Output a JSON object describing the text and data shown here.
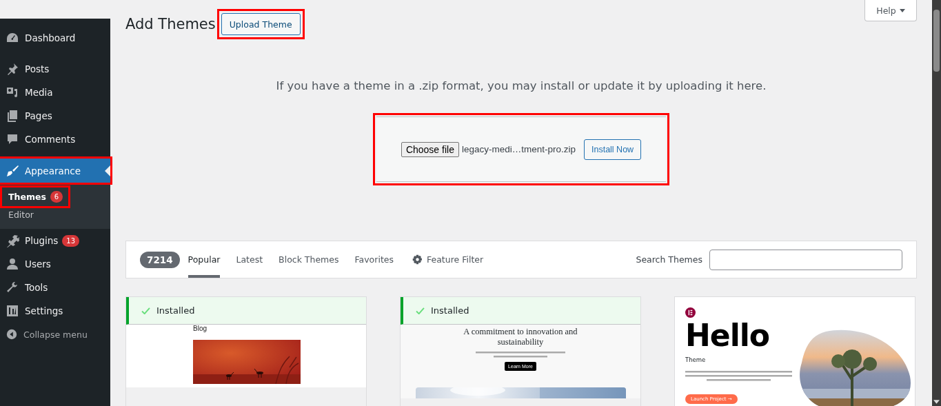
{
  "sidebar": {
    "items": [
      {
        "label": "Dashboard",
        "selected": false
      },
      {
        "label": "Posts",
        "selected": false
      },
      {
        "label": "Media",
        "selected": false
      },
      {
        "label": "Pages",
        "selected": false
      },
      {
        "label": "Comments",
        "selected": false
      },
      {
        "label": "Appearance",
        "selected": true,
        "highlighted": true,
        "children": [
          {
            "label": "Themes",
            "selected": true,
            "badge": "6",
            "highlighted": true
          },
          {
            "label": "Editor",
            "selected": false,
            "highlighted": false
          }
        ]
      },
      {
        "label": "Plugins",
        "selected": false,
        "badge": "13"
      },
      {
        "label": "Users",
        "selected": false
      },
      {
        "label": "Tools",
        "selected": false
      },
      {
        "label": "Settings",
        "selected": false
      }
    ],
    "collapse": "Collapse menu"
  },
  "help_button": {
    "label": "Help"
  },
  "page_title": "Add Themes",
  "upload_button": {
    "label": "Upload Theme",
    "highlighted": true
  },
  "upload_hint": "If you have a theme in a .zip format, you may install or update it by uploading it here.",
  "upload_form": {
    "highlighted": true,
    "file_button": "Choose file",
    "file_name": "legacy-medi…tment-pro.zip",
    "install_button": "Install Now"
  },
  "filter_bar": {
    "count": "7214",
    "tabs": [
      {
        "label": "Popular",
        "selected": true
      },
      {
        "label": "Latest",
        "selected": false
      },
      {
        "label": "Block Themes",
        "selected": false
      },
      {
        "label": "Favorites",
        "selected": false
      }
    ],
    "feature_filter": "Feature Filter",
    "search_label": "Search Themes"
  },
  "themes": [
    {
      "installed": true,
      "installed_label": "Installed",
      "preview": {
        "kind": "blog",
        "heading": "Blog"
      }
    },
    {
      "installed": true,
      "installed_label": "Installed",
      "preview": {
        "kind": "studio",
        "heading": "A commitment to innovation and sustainability",
        "button": "Learn More"
      }
    },
    {
      "installed": false,
      "preview": {
        "kind": "hello",
        "heading": "Hello",
        "subheading": "Theme",
        "button": "Launch Project →"
      }
    }
  ]
}
